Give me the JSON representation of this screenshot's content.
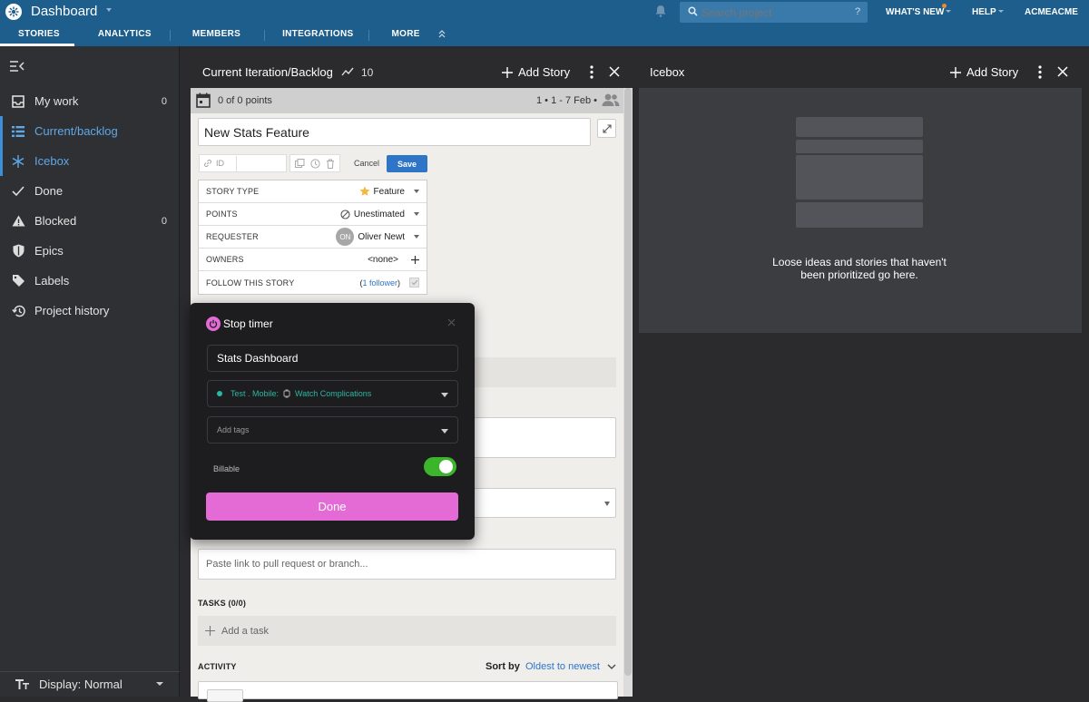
{
  "topbar": {
    "title": "Dashboard",
    "search_placeholder": "Search project",
    "search_shortcut": "?",
    "whats_new": "WHAT'S NEW",
    "help": "HELP",
    "account": "ACMEACME",
    "tabs": [
      "STORIES",
      "ANALYTICS",
      "MEMBERS",
      "INTEGRATIONS",
      "MORE"
    ]
  },
  "sidebar": {
    "items": [
      {
        "label": "My work",
        "count": "0"
      },
      {
        "label": "Current/backlog",
        "count": ""
      },
      {
        "label": "Icebox",
        "count": ""
      },
      {
        "label": "Done",
        "count": ""
      },
      {
        "label": "Blocked",
        "count": "0"
      },
      {
        "label": "Epics",
        "count": ""
      },
      {
        "label": "Labels",
        "count": ""
      },
      {
        "label": "Project history",
        "count": ""
      }
    ],
    "display": "Display: Normal"
  },
  "backlog": {
    "title": "Current Iteration/Backlog",
    "velocity": "10",
    "add_story": "Add Story",
    "points_summary": "0 of 0 points",
    "iteration": "1 • 1 - 7 Feb •"
  },
  "story": {
    "title_value": "New Stats Feature",
    "id_label": "ID",
    "cancel": "Cancel",
    "save": "Save",
    "rows": [
      {
        "label": "STORY TYPE",
        "value": "Feature"
      },
      {
        "label": "POINTS",
        "value": "Unestimated"
      },
      {
        "label": "REQUESTER",
        "value": "Oliver Newt",
        "initials": "ON"
      },
      {
        "label": "OWNERS",
        "value": "<none>"
      },
      {
        "label": "FOLLOW THIS STORY",
        "value_pre": "(",
        "value_link": "1 follower",
        "value_post": ")"
      }
    ],
    "pr_placeholder": "Paste link to pull request or branch...",
    "tasks_label": "TASKS (0/0)",
    "add_task": "Add a task",
    "activity_label": "ACTIVITY",
    "sort_by": "Sort by",
    "sort_value": "Oldest to newest"
  },
  "icebox": {
    "title": "Icebox",
    "add_story": "Add Story",
    "empty_text": "Loose ideas and stories that haven't been prioritized go here."
  },
  "timer": {
    "title": "Stop timer",
    "task_name": "Stats Dashboard",
    "project_prefix": "Test . Mobile:",
    "project_task": "Watch Complications",
    "tags_placeholder": "Add tags",
    "billable": "Billable",
    "billable_on": true,
    "done": "Done"
  },
  "colors": {
    "topbar": "#1d5e8c",
    "accent_blue": "#2e75c8",
    "timer_pink": "#e46ad6",
    "toggle_green": "#3cb52c"
  }
}
